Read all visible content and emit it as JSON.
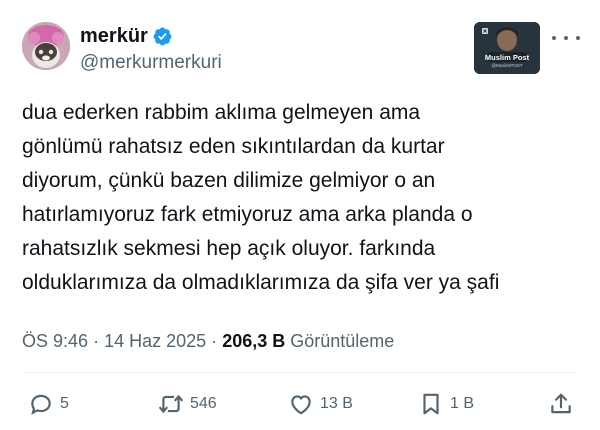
{
  "author": {
    "display_name": "merkür",
    "handle": "@merkurmerkuri",
    "verified": true,
    "avatar_icon": "cat-avatar",
    "affiliate_badge_title": "Muslim Post",
    "affiliate_badge_subtitle": "@MuslimPOST"
  },
  "tweet": {
    "lines": [
      "dua ederken rabbim aklıma gelmeyen ama",
      "gönlümü rahatsız eden sıkıntılardan da kurtar",
      "diyorum, çünkü bazen dilimize gelmiyor o an",
      "hatırlamıyoruz fark etmiyoruz ama arka planda o",
      "rahatsızlık sekmesi hep açık oluyor. farkında",
      "olduklarımıza da olmadıklarımıza da şifa ver ya şafi"
    ]
  },
  "meta": {
    "time": "ÖS 9:46",
    "separator": "·",
    "date": "14 Haz 2025",
    "views": "206,3 B",
    "views_label": "Görüntüleme"
  },
  "actions": {
    "replies": "5",
    "reposts": "546",
    "likes": "13 B",
    "bookmarks": "1 B"
  },
  "colors": {
    "text": "#0f1419",
    "secondary": "#536471",
    "verified": "#1d9bf0",
    "divider": "#eff3f4"
  }
}
